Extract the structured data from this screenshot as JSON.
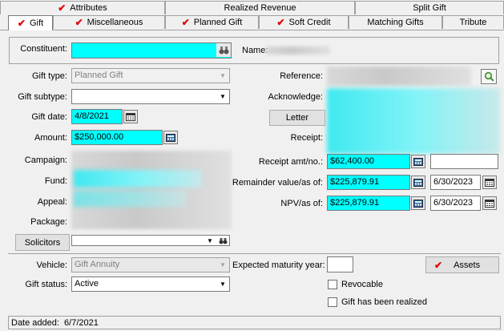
{
  "tabs_top": [
    {
      "label": "Attributes",
      "checked": true
    },
    {
      "label": "Realized Revenue",
      "checked": false
    },
    {
      "label": "Split Gift",
      "checked": false
    }
  ],
  "tabs_bottom": [
    {
      "label": "Gift",
      "checked": true
    },
    {
      "label": "Miscellaneous",
      "checked": true
    },
    {
      "label": "Planned Gift",
      "checked": true
    },
    {
      "label": "Soft Credit",
      "checked": true
    },
    {
      "label": "Matching Gifts",
      "checked": false
    },
    {
      "label": "Tribute",
      "checked": false
    }
  ],
  "form": {
    "constituent_label": "Constituent:",
    "name_label": "Name:",
    "gift_type_label": "Gift type:",
    "gift_type_value": "Planned Gift",
    "gift_subtype_label": "Gift subtype:",
    "gift_subtype_value": "",
    "gift_date_label": "Gift date:",
    "gift_date_value": "4/8/2021",
    "amount_label": "Amount:",
    "amount_value": "$250,000.00",
    "campaign_label": "Campaign:",
    "fund_label": "Fund:",
    "appeal_label": "Appeal:",
    "package_label": "Package:",
    "solicitors_button": "Solicitors",
    "reference_label": "Reference:",
    "acknowledge_label": "Acknowledge:",
    "letter_button": "Letter",
    "receipt_label": "Receipt:",
    "receipt_amt_label": "Receipt amt/no.:",
    "receipt_amt_value": "$62,400.00",
    "remainder_label": "Remainder value/as of:",
    "remainder_value": "$225,879.91",
    "remainder_date": "6/30/2023",
    "npv_label": "NPV/as of:",
    "npv_value": "$225,879.91",
    "npv_date": "6/30/2023",
    "vehicle_label": "Vehicle:",
    "vehicle_value": "Gift Annuity",
    "gift_status_label": "Gift status:",
    "gift_status_value": "Active",
    "maturity_label": "Expected maturity year:",
    "maturity_value": "",
    "assets_button": "Assets",
    "revocable_label": "Revocable",
    "realized_label": "Gift has been realized"
  },
  "status": {
    "date_added": "Date added:  6/7/2021"
  },
  "colors": {
    "required": "#00ffff",
    "check": "#e00000"
  }
}
